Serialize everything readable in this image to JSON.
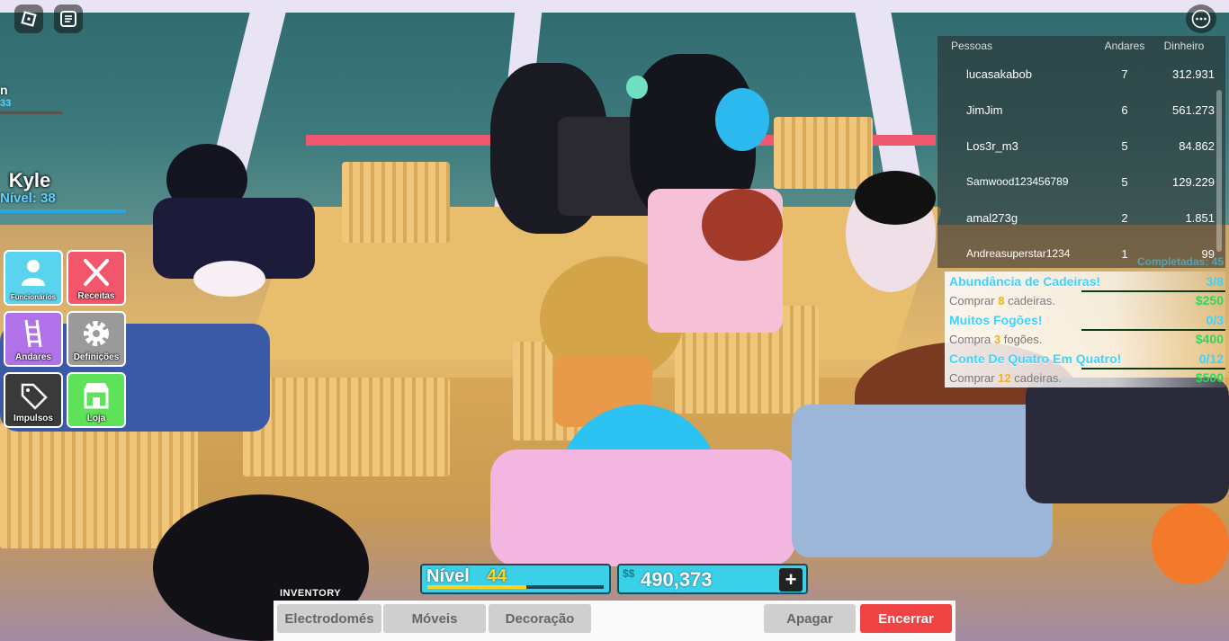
{
  "top_buttons": {
    "roblox_menu_icon": "roblox-logo-icon",
    "chat_icon": "chat-icon",
    "more_icon": "more-options-icon"
  },
  "offscreen_player": {
    "name_fragment": "n",
    "level_fragment": "33"
  },
  "player": {
    "name": "Kyle",
    "level_text": "Nível: 38"
  },
  "menu": [
    {
      "label": "Funcionários",
      "icon": "person-icon",
      "color": "#5ad4ee"
    },
    {
      "label": "Receitas",
      "icon": "fork-knife-icon",
      "color": "#f2566a"
    },
    {
      "label": "Andares",
      "icon": "ladder-icon",
      "color": "#b072e8"
    },
    {
      "label": "Definições",
      "icon": "gear-icon",
      "color": "#9a9a9a"
    },
    {
      "label": "Impulsos",
      "icon": "tag-icon",
      "color": "#3a3a3a"
    },
    {
      "label": "Loja",
      "icon": "shop-icon",
      "color": "#5ee25a"
    }
  ],
  "leaderboard": {
    "headers": [
      "Pessoas",
      "Andares",
      "Dinheiro"
    ],
    "rows": [
      {
        "name": "lucasakabob",
        "floors": "7",
        "money": "312.931"
      },
      {
        "name": "JimJim",
        "floors": "6",
        "money": "561.273"
      },
      {
        "name": "Los3r_m3",
        "floors": "5",
        "money": "84.862"
      },
      {
        "name": "Samwood123456789",
        "floors": "5",
        "money": "129.229"
      },
      {
        "name": "amal273g",
        "floors": "2",
        "money": "1.851"
      },
      {
        "name": "Andreasuperstar1234",
        "floors": "1",
        "money": "99"
      }
    ],
    "footer": "Completadas: 45"
  },
  "quests": [
    {
      "title": "Abundância de Cadeiras!",
      "progress": "3/8",
      "desc_pre": "Comprar",
      "desc_num": "8",
      "desc_post": "cadeiras.",
      "reward": "$250"
    },
    {
      "title": "Muitos Fogões!",
      "progress": "0/3",
      "desc_pre": "Compra",
      "desc_num": "3",
      "desc_post": "fogões.",
      "reward": "$400"
    },
    {
      "title": "Conte De Quatro Em Quatro!",
      "progress": "0/12",
      "desc_pre": "Comprar",
      "desc_num": "12",
      "desc_post": "cadeiras.",
      "reward": "$500"
    }
  ],
  "hud": {
    "level_label": "Nível",
    "level_value": "44",
    "level_progress": 0.56,
    "currency_symbol": "$$",
    "money": "490,373",
    "plus": "+"
  },
  "inventory": {
    "label": "INVENTORY",
    "tabs": [
      "Electrodomés",
      "Móveis",
      "Decoração"
    ],
    "erase": "Apagar",
    "close": "Encerrar"
  }
}
